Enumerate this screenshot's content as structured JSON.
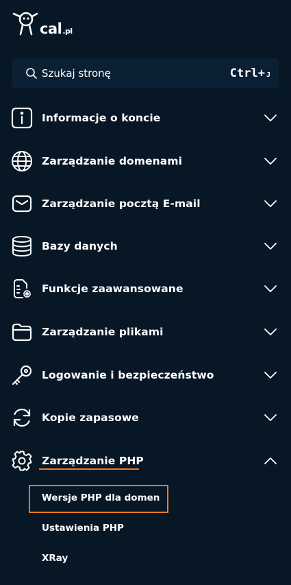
{
  "brand": {
    "logo_text": "cal",
    "logo_suffix": ".pl",
    "accent_color": "#f47a1f",
    "background_color": "#071726"
  },
  "search": {
    "placeholder": "Szukaj stronę",
    "shortcut_main": "Ctrl+",
    "shortcut_key": "J",
    "icon": "search-icon"
  },
  "menu": {
    "items": [
      {
        "label": "Informacje o koncie",
        "icon": "info-icon",
        "expanded": false
      },
      {
        "label": "Zarządzanie domenami",
        "icon": "globe-icon",
        "expanded": false
      },
      {
        "label": "Zarządzanie pocztą E-mail",
        "icon": "mail-icon",
        "expanded": false
      },
      {
        "label": "Bazy danych",
        "icon": "database-icon",
        "expanded": false
      },
      {
        "label": "Funkcje zaawansowane",
        "icon": "file-gear-icon",
        "expanded": false
      },
      {
        "label": "Zarządzanie plikami",
        "icon": "folder-icon",
        "expanded": false
      },
      {
        "label": "Logowanie i bezpieczeństwo",
        "icon": "key-icon",
        "expanded": false
      },
      {
        "label": "Kopie zapasowe",
        "icon": "refresh-icon",
        "expanded": false
      },
      {
        "label": "Zarządzanie PHP",
        "icon": "gear-icon",
        "expanded": true
      }
    ],
    "submenu": [
      {
        "label": "Wersje PHP dla domen",
        "highlighted": true
      },
      {
        "label": "Ustawienia PHP",
        "highlighted": false
      },
      {
        "label": "XRay",
        "highlighted": false
      }
    ]
  }
}
